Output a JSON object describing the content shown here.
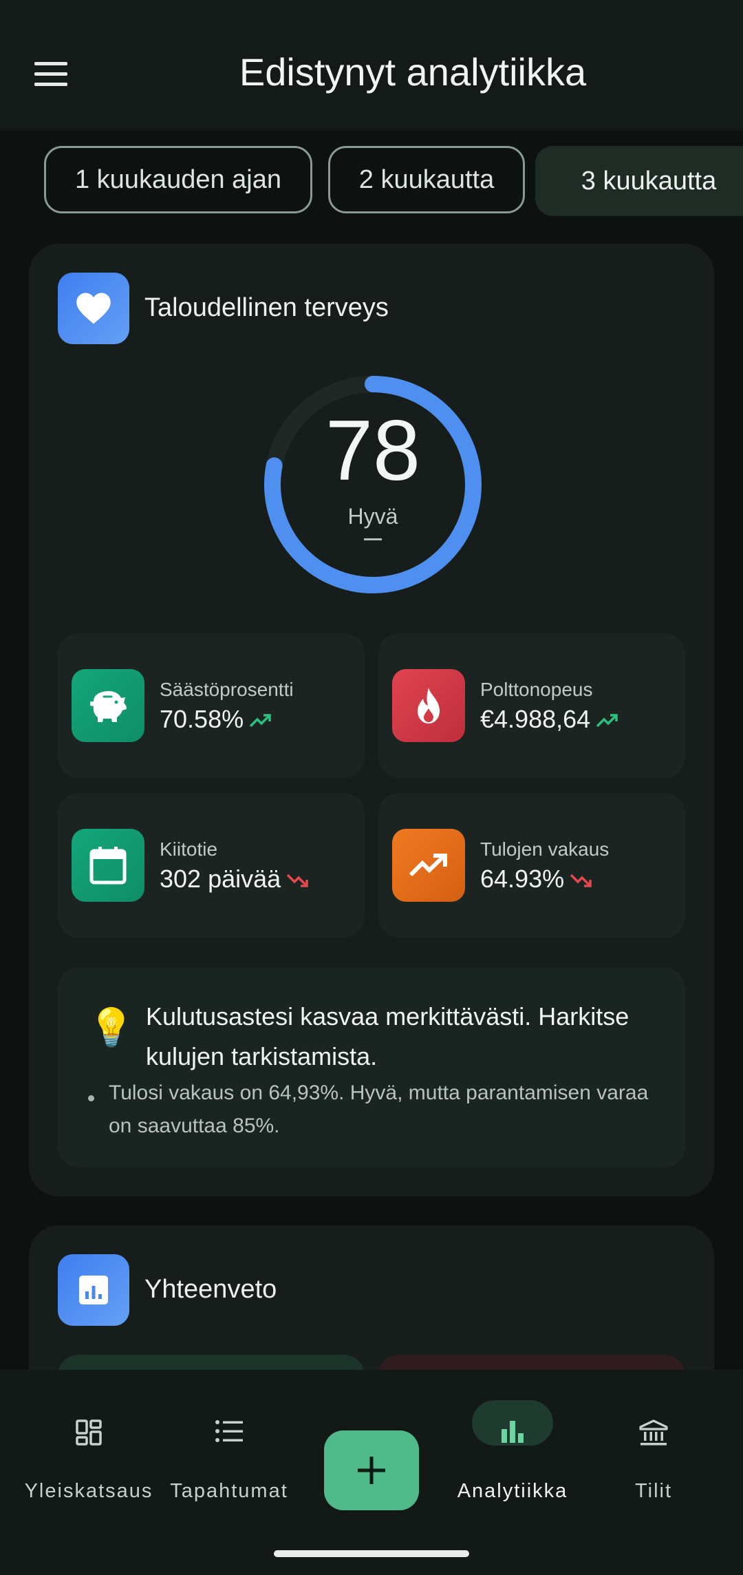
{
  "app_bar": {
    "title": "Edistynyt analytiikka"
  },
  "period_chips": [
    {
      "label": "1 kuukauden ajan",
      "selected": false
    },
    {
      "label": "2 kuukautta",
      "selected": false
    },
    {
      "label": "3 kuukautta",
      "selected": true
    }
  ],
  "health_card": {
    "title": "Taloudellinen terveys",
    "icon": "heart-icon",
    "score": "78",
    "score_fraction": 0.78,
    "score_label": "Hyvä",
    "score_sub": "–",
    "ring_color": "#4e8ff0",
    "metrics": [
      {
        "label": "Säästöprosentti",
        "value": "70.58%",
        "icon": "piggy-bank-icon",
        "trend": "up",
        "color": "#16a37a"
      },
      {
        "label": "Polttonopeus",
        "value": "€4.988,64",
        "icon": "flame-icon",
        "trend": "up",
        "color": "#d9394a"
      },
      {
        "label": "Kiitotie",
        "value": "302 päivää",
        "icon": "calendar-icon",
        "trend": "down",
        "color": "#16a37a"
      },
      {
        "label": "Tulojen vakaus",
        "value": "64.93%",
        "icon": "trending-up-icon",
        "trend": "down",
        "color": "#e36e1c"
      }
    ],
    "tip": {
      "icon": "lightbulb-icon",
      "title": "Kulutusastesi kasvaa merkittävästi. Harkitse kulujen tarkistamista.",
      "bullet": "Tulosi vakaus on 64,93%. Hyvä, mutta parantamisen varaa on saavuttaa 85%."
    }
  },
  "summary_card": {
    "title": "Yhteenveto",
    "icon": "bar-chart-icon"
  },
  "bottom_nav": {
    "items": [
      {
        "label": "Yleiskatsaus",
        "icon": "dashboard-icon"
      },
      {
        "label": "Tapahtumat",
        "icon": "list-icon"
      },
      {
        "label": "Analytiikka",
        "icon": "analytics-icon",
        "active": true
      },
      {
        "label": "Tilit",
        "icon": "bank-icon"
      }
    ],
    "fab_icon": "plus-icon"
  },
  "colors": {
    "accent": "#4fb98a",
    "up": "#2bbf80",
    "down": "#e5484d"
  }
}
